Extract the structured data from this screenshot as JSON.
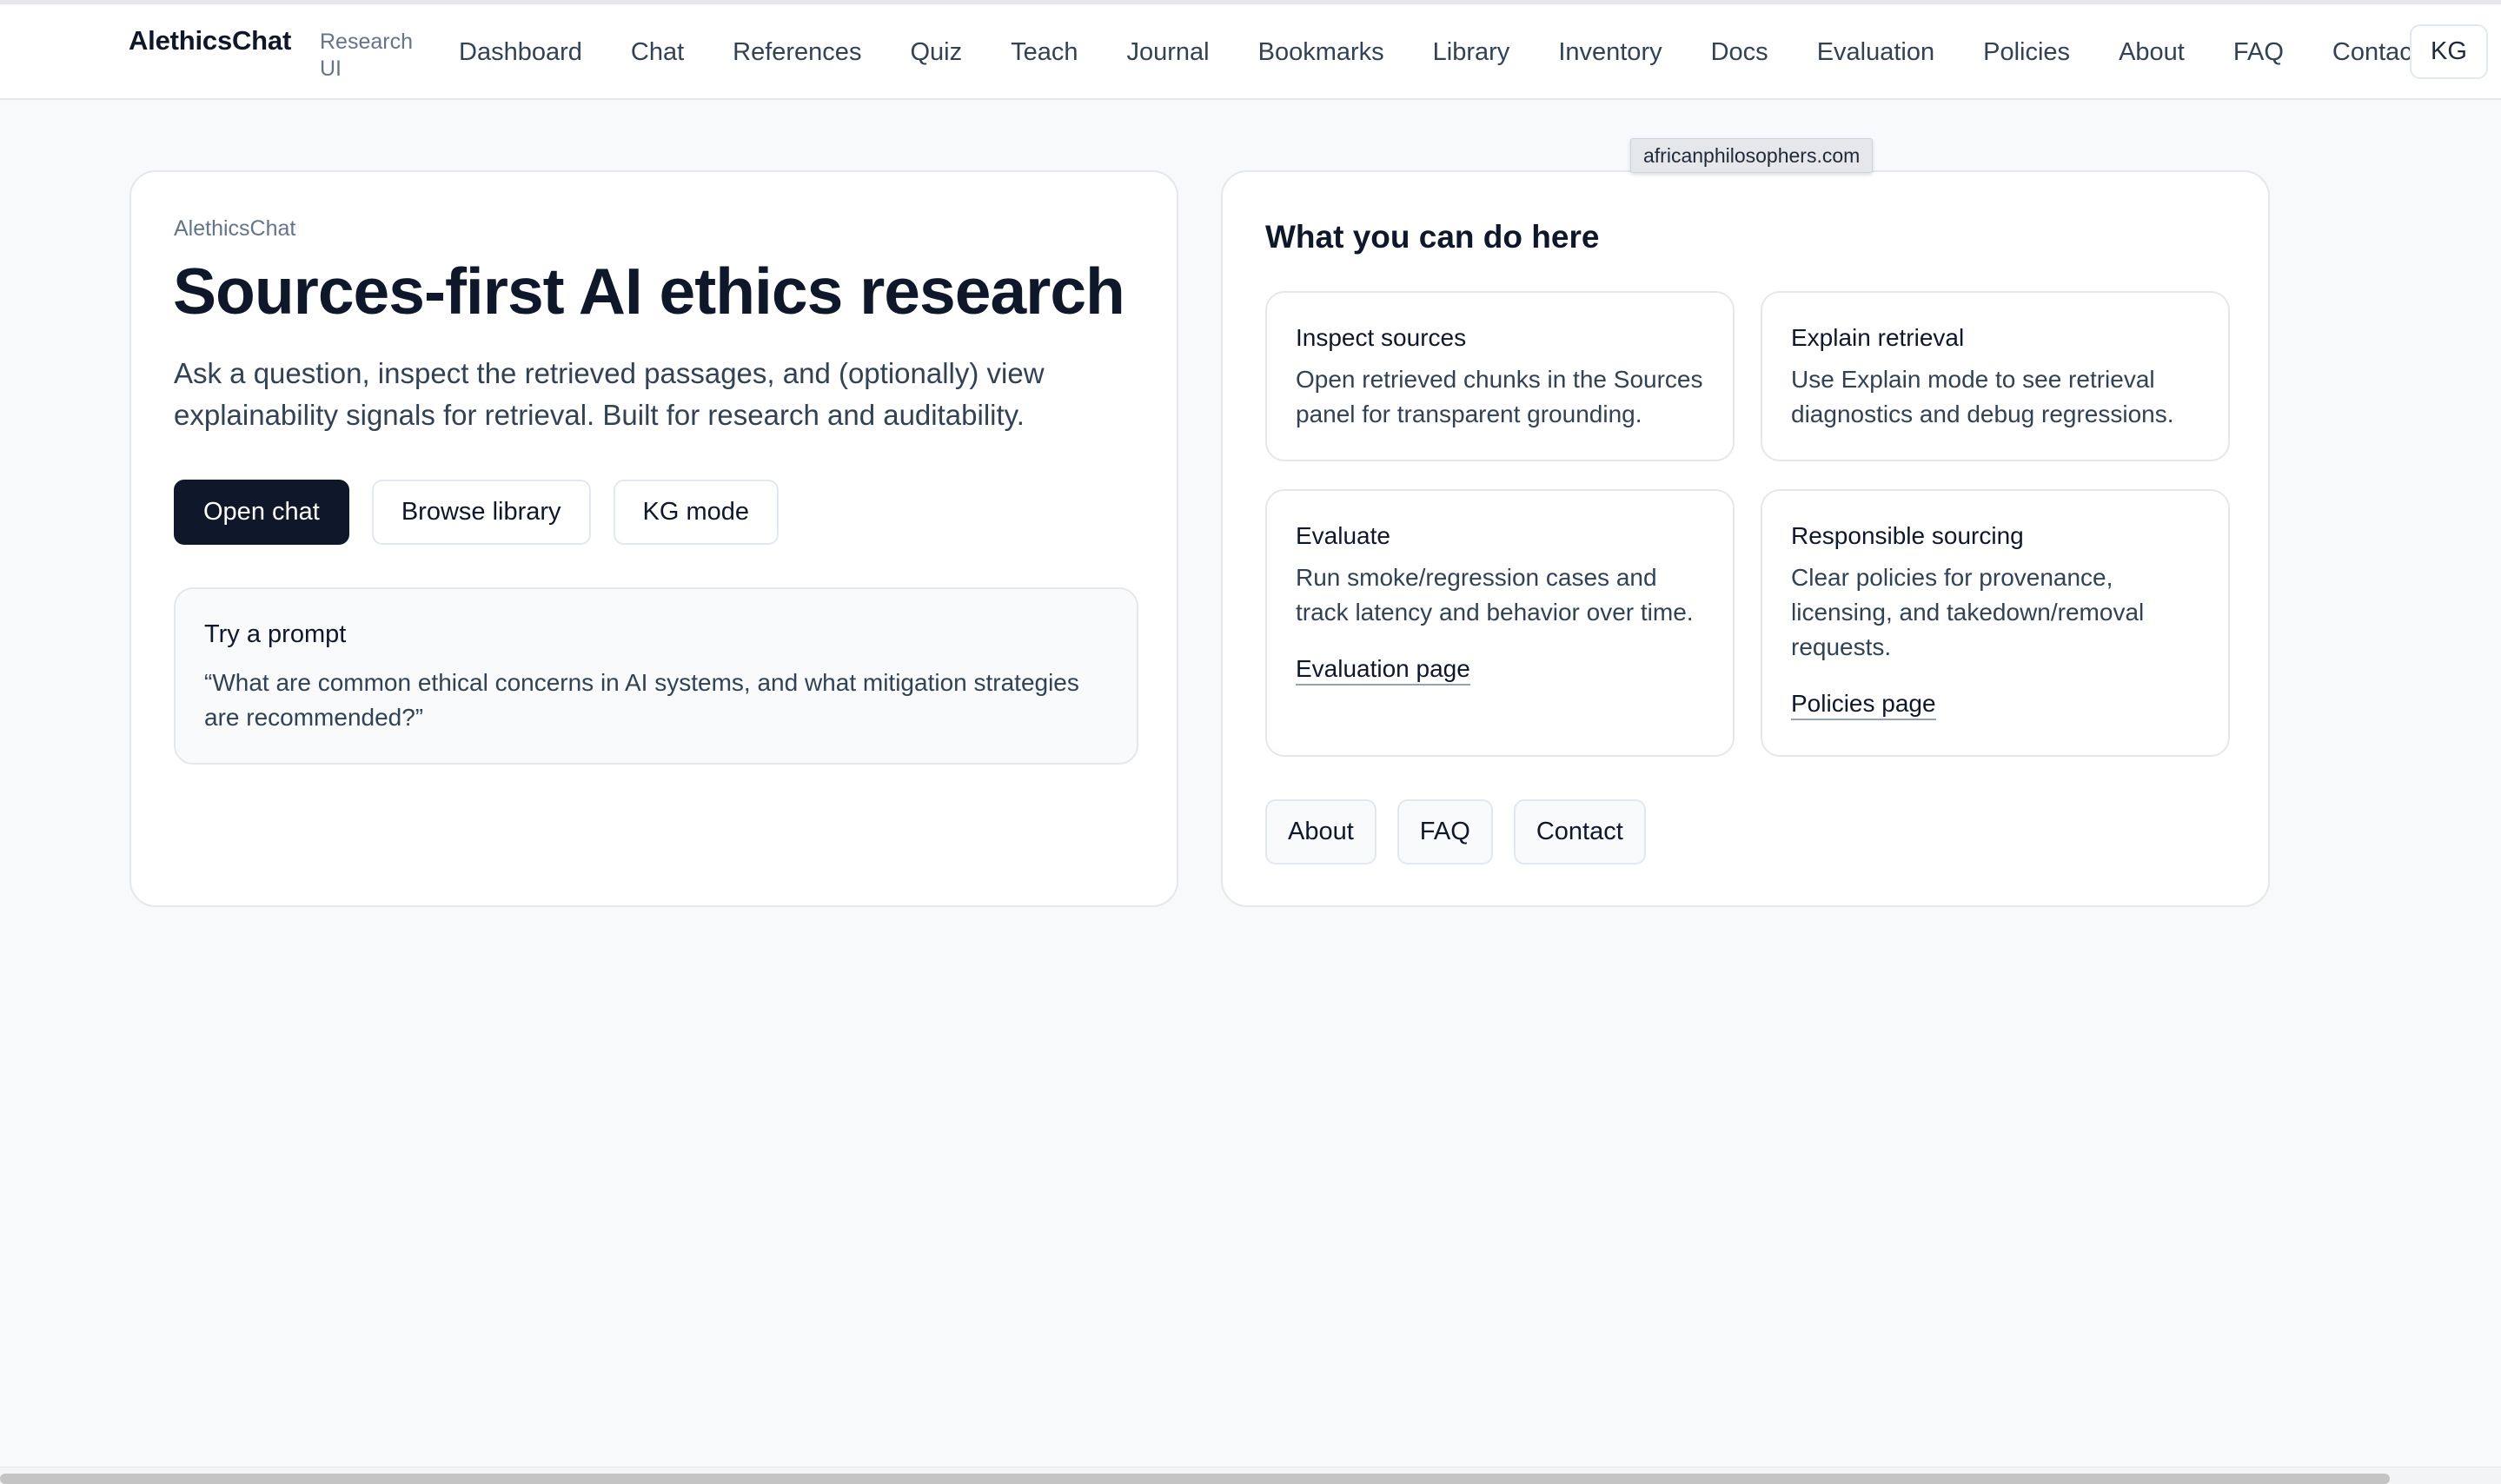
{
  "header": {
    "brand": "AlethicsChat",
    "brand_sub": "Research UI",
    "nav": [
      "Dashboard",
      "Chat",
      "References",
      "Quiz",
      "Teach",
      "Journal",
      "Bookmarks",
      "Library",
      "Inventory",
      "Docs",
      "Evaluation",
      "Policies",
      "About",
      "FAQ",
      "Contact"
    ],
    "kg_label": "KG"
  },
  "hero": {
    "eyebrow": "AlethicsChat",
    "title": "Sources-first AI ethics research",
    "description": "Ask a question, inspect the retrieved passages, and (optionally) view explainability signals for retrieval. Built for research and auditability.",
    "buttons": {
      "open_chat": "Open chat",
      "browse_library": "Browse library",
      "kg_mode": "KG mode"
    },
    "prompt": {
      "label": "Try a prompt",
      "text": "“What are common ethical concerns in AI systems, and what mitigation strategies are recommended?”"
    }
  },
  "features": {
    "title": "What you can do here",
    "cards": [
      {
        "title": "Inspect sources",
        "desc": "Open retrieved chunks in the Sources panel for transparent grounding."
      },
      {
        "title": "Explain retrieval",
        "desc": "Use Explain mode to see retrieval diagnostics and debug regressions."
      },
      {
        "title": "Evaluate",
        "desc": "Run smoke/regression cases and track latency and behavior over time.",
        "link": "Evaluation page"
      },
      {
        "title": "Responsible sourcing",
        "desc": "Clear policies for provenance, licensing, and takedown/removal requests.",
        "link": "Policies page"
      }
    ],
    "bottom_buttons": [
      "About",
      "FAQ",
      "Contact"
    ]
  },
  "tooltip": "africanphilosophers.com",
  "colors": {
    "primary": "#0f172a",
    "background": "#f8f9fb",
    "border": "#e5e7eb"
  }
}
